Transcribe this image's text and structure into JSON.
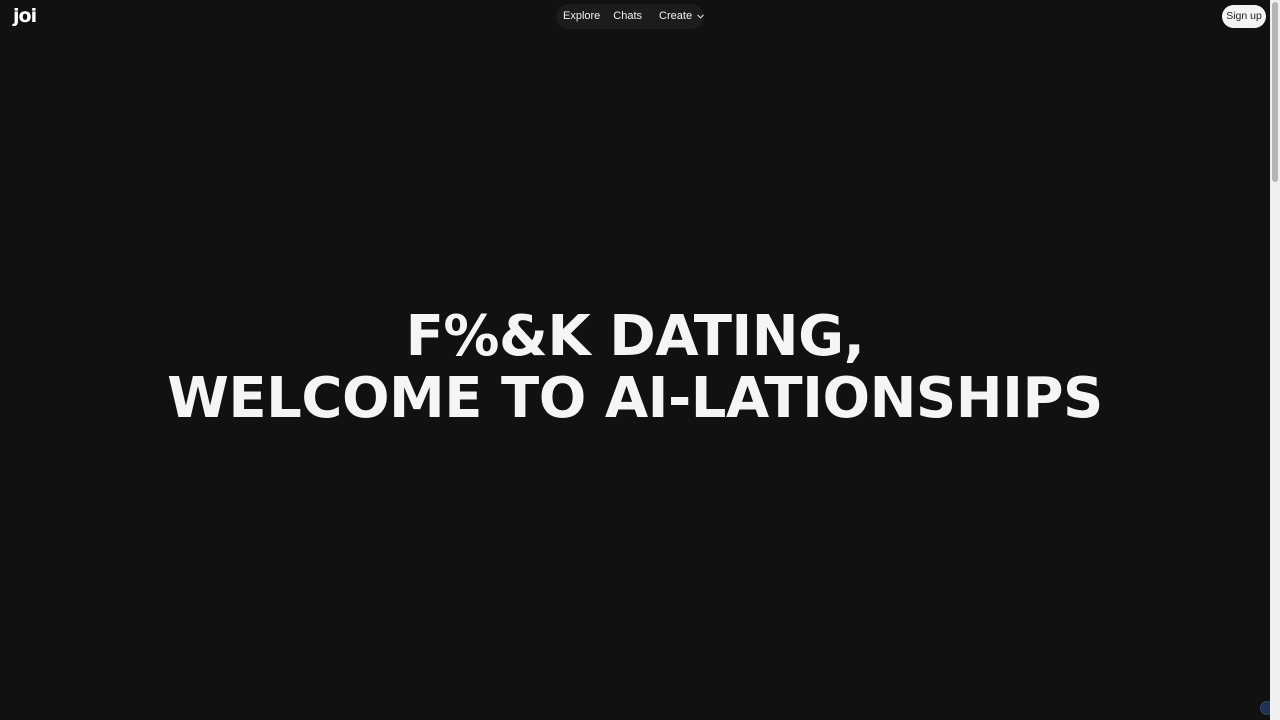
{
  "header": {
    "logo_text": "joi",
    "nav": {
      "explore_label": "Explore",
      "chats_label": "Chats",
      "create_label": "Create"
    },
    "signup_label": "Sign up"
  },
  "hero": {
    "line1": "F%&K DATING,",
    "line2": "WELCOME TO AI-LATIONSHIPS"
  },
  "colors": {
    "background": "#111111",
    "nav_pill": "#1c1c1c",
    "signup_bg": "#f4f4f4",
    "text": "#ffffff"
  },
  "icons": {
    "create_dropdown": "chevron-down-icon",
    "badge": "badge-icon"
  }
}
